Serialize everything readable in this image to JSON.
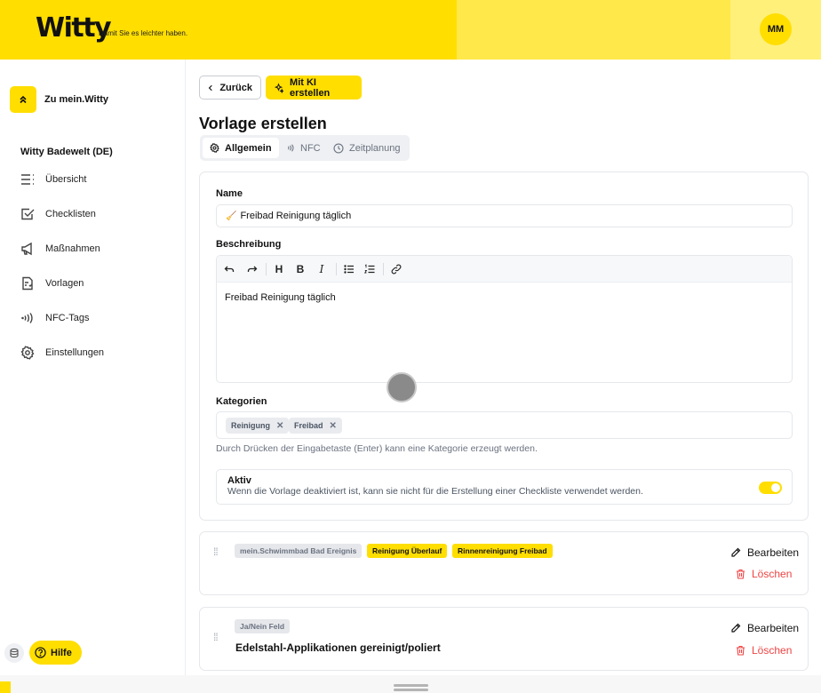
{
  "header": {
    "logo": "Witty",
    "tagline": "Damit Sie es leichter haben.",
    "user_initials": "MM"
  },
  "sidebar": {
    "back_label": "Zu mein.Witty",
    "org_name": "Witty Badewelt (DE)",
    "items": [
      {
        "label": "Übersicht",
        "icon": "list-icon"
      },
      {
        "label": "Checklisten",
        "icon": "checkbox-icon"
      },
      {
        "label": "Maßnahmen",
        "icon": "megaphone-icon"
      },
      {
        "label": "Vorlagen",
        "icon": "template-icon"
      },
      {
        "label": "NFC-Tags",
        "icon": "nfc-icon"
      },
      {
        "label": "Einstellungen",
        "icon": "gear-icon"
      }
    ],
    "help_label": "Hilfe"
  },
  "toolbar": {
    "back_label": "Zurück",
    "ai_label": "Mit KI erstellen"
  },
  "page": {
    "title": "Vorlage erstellen"
  },
  "tabs": [
    {
      "label": "Allgemein",
      "active": true
    },
    {
      "label": "NFC",
      "active": false
    },
    {
      "label": "Zeitplanung",
      "active": false
    }
  ],
  "form": {
    "name_label": "Name",
    "name_value": "Freibad Reinigung täglich",
    "name_emoji": "🧹",
    "description_label": "Beschreibung",
    "description_value": "Freibad Reinigung täglich",
    "editor_tools": [
      "undo",
      "redo",
      "H",
      "B",
      "I",
      "bullet-list",
      "numbered-list",
      "link"
    ],
    "categories_label": "Kategorien",
    "categories": [
      "Reinigung",
      "Freibad"
    ],
    "categories_hint": "Durch Drücken der Eingabetaste (Enter) kann eine Kategorie erzeugt werden.",
    "active_title": "Aktiv",
    "active_desc": "Wenn die Vorlage deaktiviert ist, kann sie nicht für die Erstellung einer Checkliste verwendet werden.",
    "active_on": true
  },
  "items": [
    {
      "tags": [
        {
          "text": "mein.Schwimmbad Bad Ereignis",
          "style": "gray"
        },
        {
          "text": "Reinigung Überlauf",
          "style": "yellow"
        },
        {
          "text": "Rinnenreinigung Freibad",
          "style": "yellow"
        }
      ],
      "title": "",
      "edit_label": "Bearbeiten",
      "delete_label": "Löschen"
    },
    {
      "tags": [
        {
          "text": "Ja/Nein Feld",
          "style": "gray"
        }
      ],
      "title": "Edelstahl-Applikationen gereinigt/poliert",
      "edit_label": "Bearbeiten",
      "delete_label": "Löschen"
    }
  ],
  "colors": {
    "brand": "#ffde00",
    "danger": "#ef4444"
  }
}
